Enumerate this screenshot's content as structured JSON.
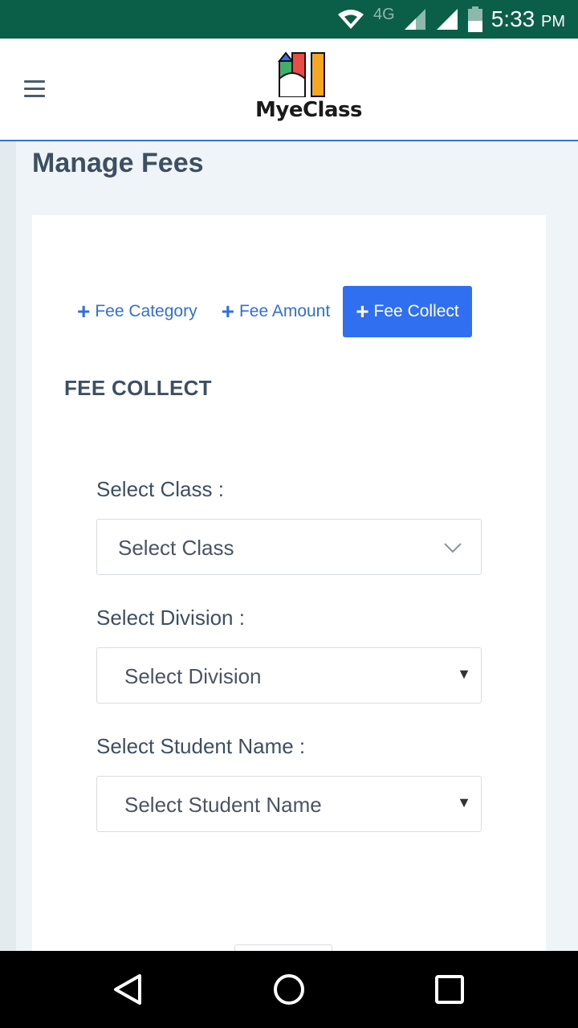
{
  "status_bar": {
    "network_label": "4G",
    "time": "5:33",
    "ampm": "PM",
    "icons": [
      "wifi-icon",
      "signal-icon",
      "signal-icon",
      "battery-icon"
    ]
  },
  "header": {
    "brand": "MyeClass",
    "menu_icon": "hamburger-icon"
  },
  "page": {
    "title": "Manage Fees"
  },
  "tabs": [
    {
      "label": "Fee Category",
      "active": false
    },
    {
      "label": "Fee Amount",
      "active": false
    },
    {
      "label": "Fee Collect",
      "active": true
    }
  ],
  "form": {
    "heading": "FEE COLLECT",
    "class_label": "Select Class :",
    "class_value": "Select Class",
    "division_label": "Select Division :",
    "division_value": "Select Division",
    "student_label": "Select Student Name :",
    "student_value": "Select Student Name"
  },
  "colors": {
    "status_bar": "#0b5e48",
    "accent": "#2f6ff0",
    "text": "#3d4f63"
  },
  "nav": [
    "back-icon",
    "home-icon",
    "recents-icon"
  ]
}
